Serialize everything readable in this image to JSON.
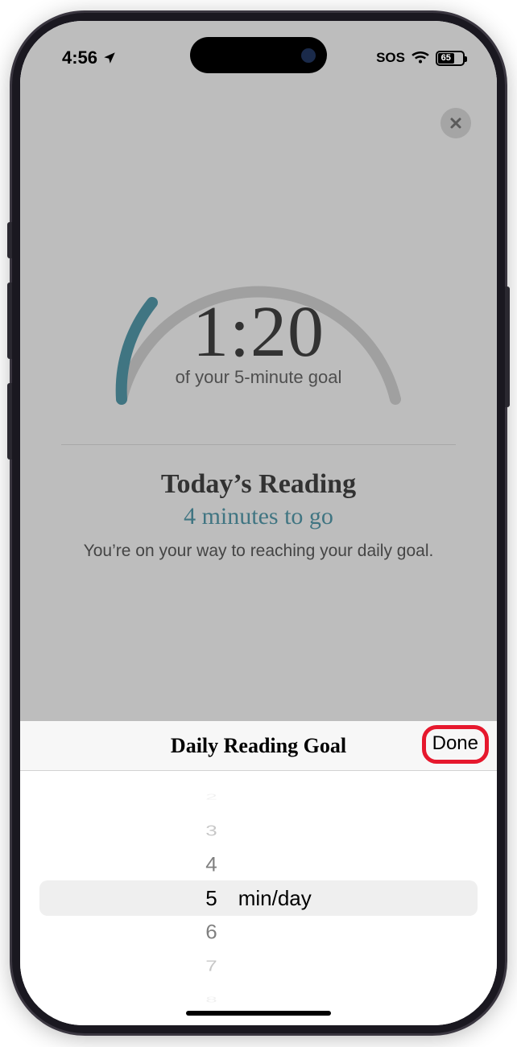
{
  "status": {
    "time": "4:56",
    "sos_label": "SOS",
    "battery_pct": "65"
  },
  "gauge": {
    "time_elapsed": "1:20",
    "subtitle": "of your 5-minute goal"
  },
  "summary": {
    "heading": "Today’s Reading",
    "remaining": "4 minutes to go",
    "encouragement": "You’re on your way to reaching your daily goal."
  },
  "sheet": {
    "title": "Daily Reading Goal",
    "done_label": "Done",
    "unit_label": "min/day",
    "options": [
      "2",
      "3",
      "4",
      "5",
      "6",
      "7",
      "8"
    ],
    "selected": "5"
  }
}
